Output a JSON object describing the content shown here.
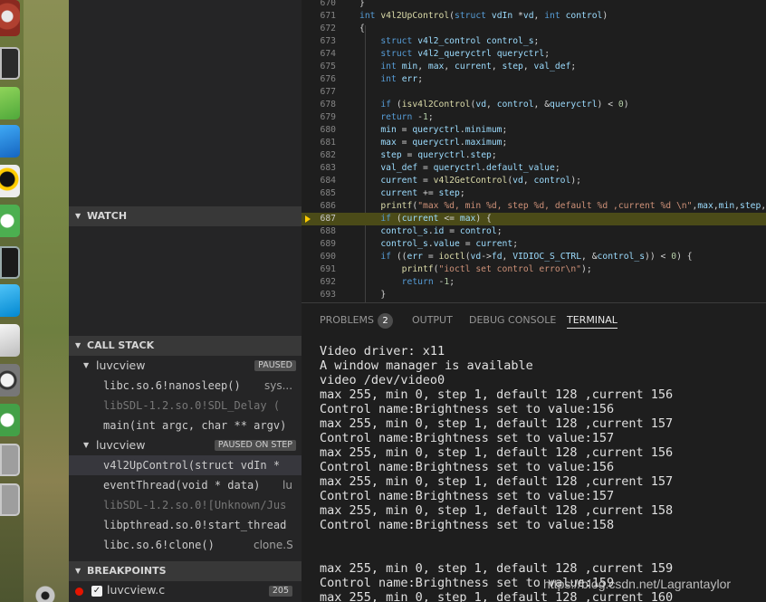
{
  "launcher": {
    "icons": [
      "settings-icon",
      "terminal-icon",
      "text-editor-icon",
      "vscode-icon",
      "qq-icon",
      "wechat-icon",
      "system-monitor-icon",
      "baidu-cloud-icon",
      "text-edit-icon",
      "clock-icon",
      "wechat-icon",
      "unknown-app-icon",
      "unknown-app-icon"
    ]
  },
  "sidebar": {
    "watch_header": "WATCH",
    "callstack_header": "CALL STACK",
    "breakpoints_header": "BREAKPOINTS",
    "threads": [
      {
        "name": "luvcview",
        "state": "PAUSED",
        "frames": [
          {
            "fn": "libc.so.6!nanosleep()",
            "src": "sys..."
          },
          {
            "fn": "libSDL-1.2.so.0!SDL_Delay (",
            "src": ""
          },
          {
            "fn": "main(int argc, char ** argv)",
            "src": ""
          }
        ]
      },
      {
        "name": "luvcview",
        "state": "PAUSED ON STEP",
        "frames": [
          {
            "fn": "v4l2UpControl(struct vdIn *",
            "src": ""
          },
          {
            "fn": "eventThread(void * data)",
            "src": "lu"
          },
          {
            "fn": "libSDL-1.2.so.0![Unknown/Jus",
            "src": ""
          },
          {
            "fn": "libpthread.so.0!start_thread",
            "src": ""
          },
          {
            "fn": "libc.so.6!clone()",
            "src": "clone.S"
          }
        ]
      }
    ],
    "breakpoint": {
      "file": "luvcview.c",
      "line": "205"
    }
  },
  "editor": {
    "current_line": "687",
    "lines": [
      {
        "n": "670",
        "t": "}"
      },
      {
        "n": "671",
        "t": "int v4l2UpControl(struct vdIn *vd, int control)"
      },
      {
        "n": "672",
        "t": "{"
      },
      {
        "n": "673",
        "t": "    struct v4l2_control control_s;"
      },
      {
        "n": "674",
        "t": "    struct v4l2_queryctrl queryctrl;"
      },
      {
        "n": "675",
        "t": "    int min, max, current, step, val_def;"
      },
      {
        "n": "676",
        "t": "    int err;"
      },
      {
        "n": "677",
        "t": ""
      },
      {
        "n": "678",
        "t": "    if (isv4l2Control(vd, control, &queryctrl) < 0)"
      },
      {
        "n": "679",
        "t": "    return -1;"
      },
      {
        "n": "680",
        "t": "    min = queryctrl.minimum;"
      },
      {
        "n": "681",
        "t": "    max = queryctrl.maximum;"
      },
      {
        "n": "682",
        "t": "    step = queryctrl.step;"
      },
      {
        "n": "683",
        "t": "    val_def = queryctrl.default_value;"
      },
      {
        "n": "684",
        "t": "    current = v4l2GetControl(vd, control);"
      },
      {
        "n": "685",
        "t": "    current += step;"
      },
      {
        "n": "686",
        "t": "    printf(\"max %d, min %d, step %d, default %d ,current %d \\n\",max,min,step,val_def,current);"
      },
      {
        "n": "687",
        "t": "    if (current <= max) {"
      },
      {
        "n": "688",
        "t": "    control_s.id = control;"
      },
      {
        "n": "689",
        "t": "    control_s.value = current;"
      },
      {
        "n": "690",
        "t": "    if ((err = ioctl(vd->fd, VIDIOC_S_CTRL, &control_s)) < 0) {"
      },
      {
        "n": "691",
        "t": "        printf(\"ioctl set control error\\n\");"
      },
      {
        "n": "692",
        "t": "        return -1;"
      },
      {
        "n": "693",
        "t": "    }"
      }
    ]
  },
  "panel": {
    "tabs": [
      {
        "label": "PROBLEMS",
        "badge": "2"
      },
      {
        "label": "OUTPUT"
      },
      {
        "label": "DEBUG CONSOLE"
      },
      {
        "label": "TERMINAL"
      }
    ],
    "terminal_lines": [
      "Video driver: x11",
      "A window manager is available",
      "video /dev/video0",
      "max 255, min 0, step 1, default 128 ,current 156",
      "Control name:Brightness set to value:156",
      "max 255, min 0, step 1, default 128 ,current 157",
      "Control name:Brightness set to value:157",
      "max 255, min 0, step 1, default 128 ,current 156",
      "Control name:Brightness set to value:156",
      "max 255, min 0, step 1, default 128 ,current 157",
      "Control name:Brightness set to value:157",
      "max 255, min 0, step 1, default 128 ,current 158",
      "Control name:Brightness set to value:158",
      "",
      "",
      "max 255, min 0, step 1, default 128 ,current 159",
      "Control name:Brightness set to value:159",
      "max 255, min 0, step 1, default 128 ,current 160"
    ],
    "watermark": "https://blog.csdn.net/Lagrantaylor"
  },
  "settings_icon": "gear-icon"
}
